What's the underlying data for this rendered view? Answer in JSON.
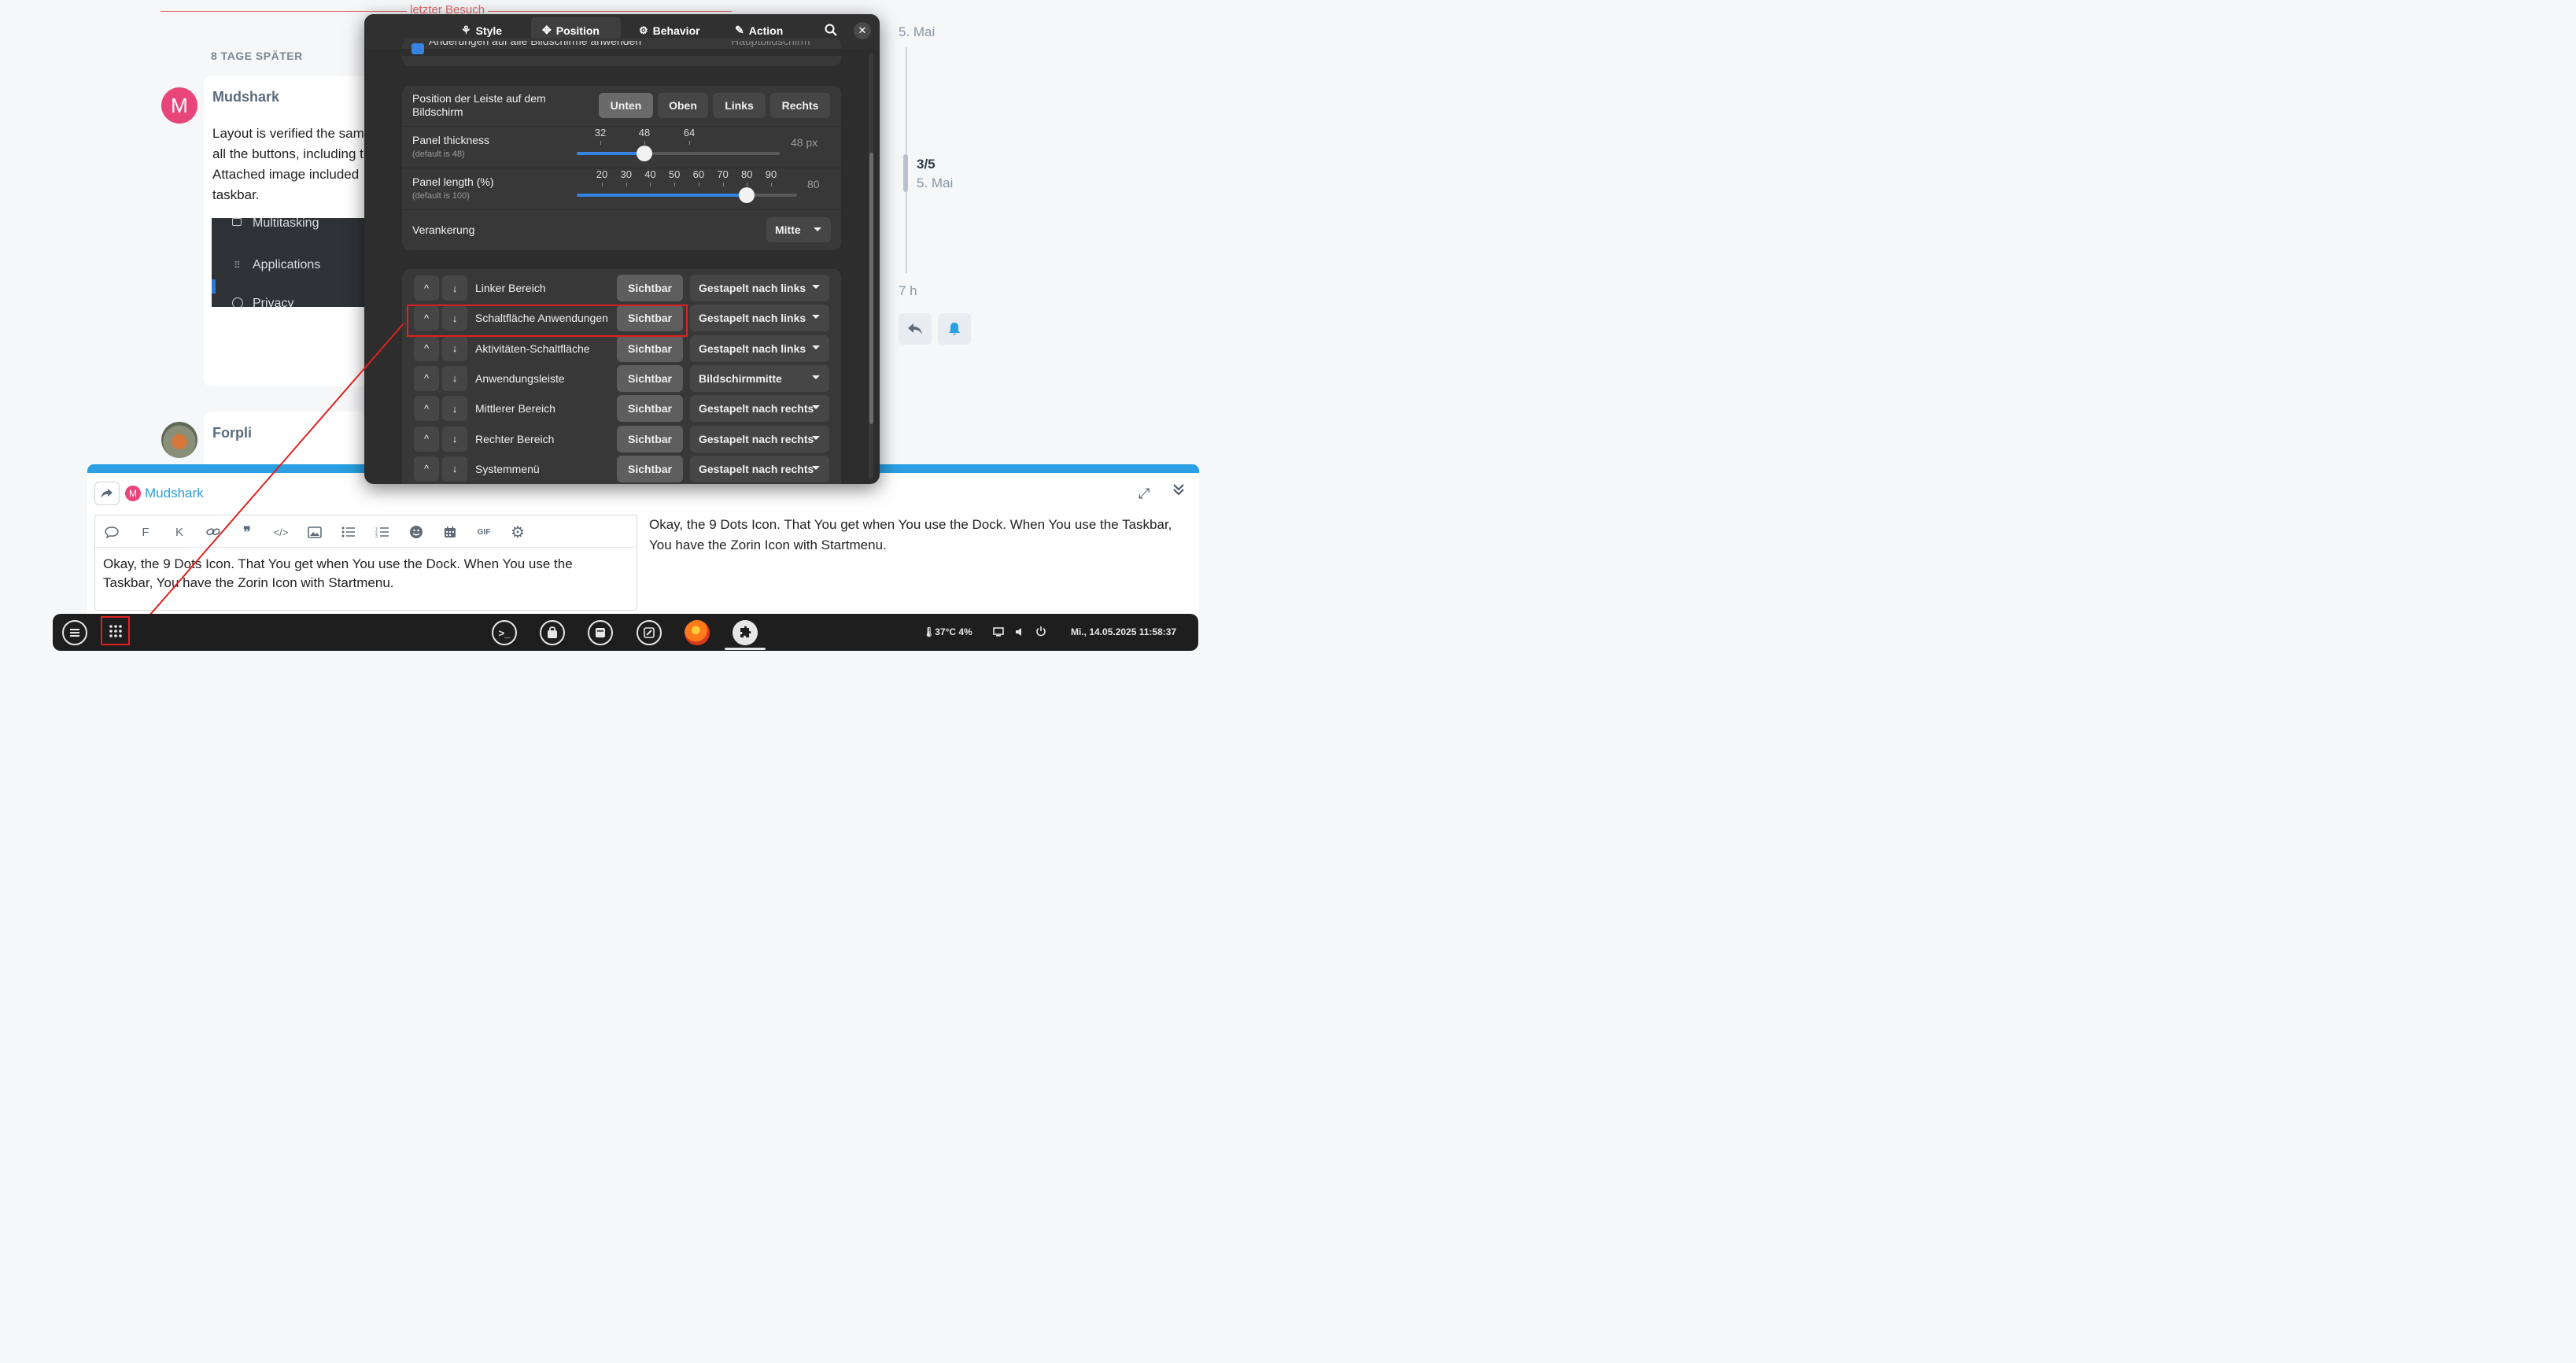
{
  "forum": {
    "last_visit_label": "letzter Besuch",
    "days_later": "8 TAGE SPÄTER",
    "post1": {
      "avatar_letter": "M",
      "author": "Mudshark",
      "lines": [
        "Layout is verified the sam",
        "all the buttons, including t",
        "Attached image included",
        "taskbar."
      ],
      "embed_items": [
        "Multitasking",
        "Applications",
        "Privacy"
      ]
    },
    "post2": {
      "author": "Forpli"
    },
    "timeline": {
      "top_date": "5. Mai",
      "position": "3/5",
      "position_date": "5. Mai",
      "bottom": "7 h"
    }
  },
  "composer": {
    "reply_to_avatar": "M",
    "reply_to": "Mudshark",
    "toolbar": [
      "quote",
      "F",
      "K",
      "link",
      "blockquote",
      "code",
      "image",
      "bullet-list",
      "numbered-list",
      "emoji",
      "date",
      "GIF",
      "settings"
    ],
    "toolbar_gif": "GIF",
    "toolbar_bold": "F",
    "toolbar_italic": "K",
    "editor_text": "Okay, the 9 Dots Icon. That You get when You use the Dock. When You use the Taskbar, You have the Zorin Icon with Startmenu.",
    "preview_text": "Okay, the 9 Dots Icon. That You get when You use the Dock. When You use the Taskbar, You have the Zorin Icon with Startmenu."
  },
  "dialog": {
    "tabs": [
      {
        "label": "Style",
        "icon": "style-icon"
      },
      {
        "label": "Position",
        "icon": "position-icon"
      },
      {
        "label": "Behavior",
        "icon": "behavior-icon"
      },
      {
        "label": "Action",
        "icon": "action-icon"
      }
    ],
    "active_tab": "Position",
    "cutoff_row": {
      "label": "Änderungen auf alle Bildschirme anwenden",
      "value": "Hauptbildschirm"
    },
    "position_label": "Position der Leiste auf dem Bildschirm",
    "position_options": [
      "Unten",
      "Oben",
      "Links",
      "Rechts"
    ],
    "position_selected": "Unten",
    "thickness": {
      "label": "Panel thickness",
      "default": "(default is 48)",
      "ticks": [
        "32",
        "48",
        "64"
      ],
      "value": 48,
      "range": [
        16,
        128
      ],
      "display": "48 px"
    },
    "length": {
      "label": "Panel length (%)",
      "default": "(default is 100)",
      "ticks": [
        "20",
        "30",
        "40",
        "50",
        "60",
        "70",
        "80",
        "90"
      ],
      "value": 80,
      "range": [
        10,
        100
      ],
      "display": "80"
    },
    "anchor": {
      "label": "Verankerung",
      "value": "Mitte"
    },
    "elements": [
      {
        "name": "Linker Bereich",
        "visibility": "Sichtbar",
        "position": "Gestapelt nach links"
      },
      {
        "name": "Schaltfläche Anwendungen",
        "visibility": "Sichtbar",
        "position": "Gestapelt nach links",
        "highlighted": true
      },
      {
        "name": "Aktivitäten-Schaltfläche",
        "visibility": "Sichtbar",
        "position": "Gestapelt nach links"
      },
      {
        "name": "Anwendungsleiste",
        "visibility": "Sichtbar",
        "position": "Bildschirmmitte"
      },
      {
        "name": "Mittlerer Bereich",
        "visibility": "Sichtbar",
        "position": "Gestapelt nach rechts"
      },
      {
        "name": "Rechter Bereich",
        "visibility": "Sichtbar",
        "position": "Gestapelt nach rechts"
      },
      {
        "name": "Systemmenü",
        "visibility": "Sichtbar",
        "position": "Gestapelt nach rechts"
      }
    ],
    "move_up": "^",
    "move_down": "↓"
  },
  "taskbar": {
    "apps": [
      "zorin-menu-icon",
      "app-grid-icon",
      "terminal-icon",
      "software-store-icon",
      "files-icon",
      "text-editor-icon",
      "firefox-icon",
      "extensions-icon"
    ],
    "weather": "37°C 4%",
    "clock": "Mi., 14.05.2025  11:58:37"
  },
  "colors": {
    "accent_blue": "#3584e4",
    "annotation_red": "#e02020",
    "composer_bar": "#2a9fe1",
    "avatar_pink": "#e8457b"
  }
}
